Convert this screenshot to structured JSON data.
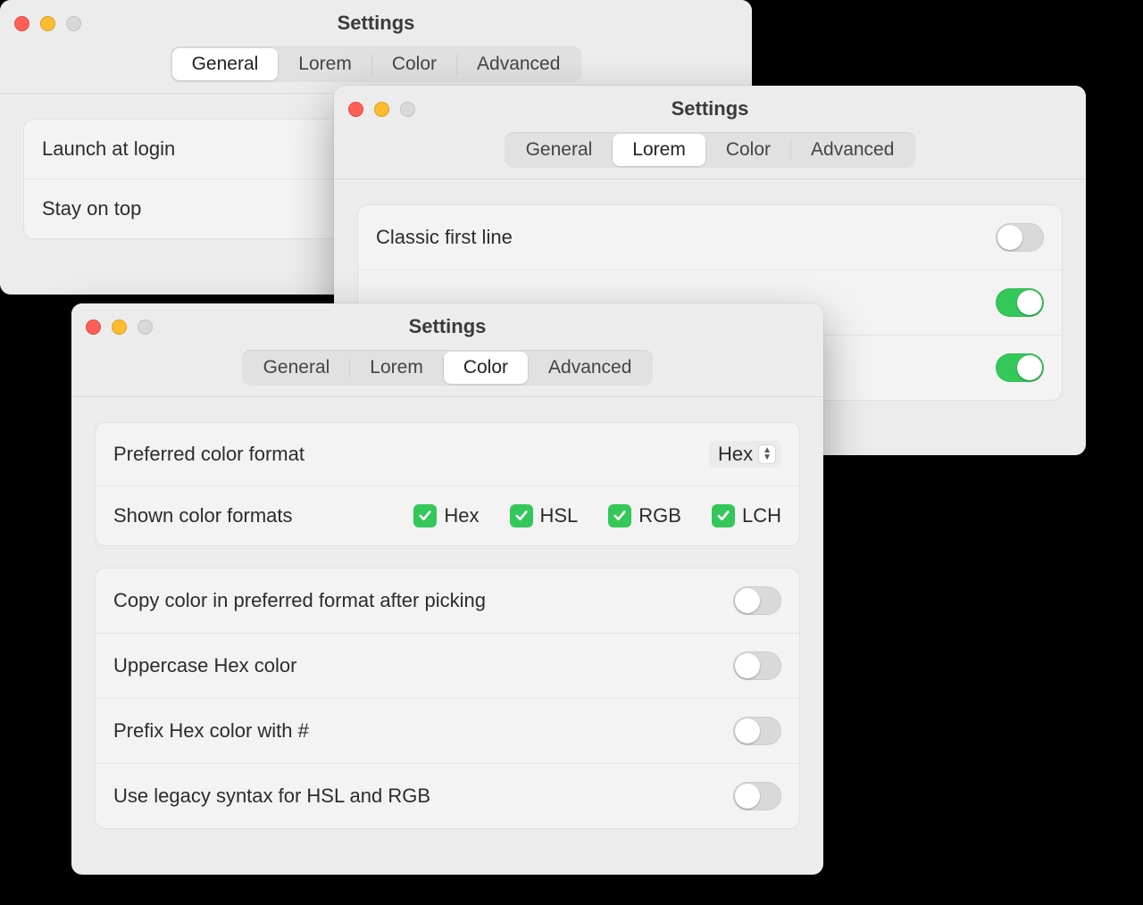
{
  "windows": {
    "general": {
      "title": "Settings",
      "tabs": [
        "General",
        "Lorem",
        "Color",
        "Advanced"
      ],
      "active_tab": "General",
      "rows": {
        "launch": "Launch at login",
        "stayontop": "Stay on top"
      }
    },
    "lorem": {
      "title": "Settings",
      "tabs": [
        "General",
        "Lorem",
        "Color",
        "Advanced"
      ],
      "active_tab": "Lorem",
      "rows": {
        "classic": "Classic first line"
      },
      "toggles": {
        "classic": false,
        "row2": true,
        "row3": true
      }
    },
    "color": {
      "title": "Settings",
      "tabs": [
        "General",
        "Lorem",
        "Color",
        "Advanced"
      ],
      "active_tab": "Color",
      "pref_format_label": "Preferred color format",
      "pref_format_value": "Hex",
      "shown_label": "Shown color formats",
      "formats": {
        "hex": "Hex",
        "hsl": "HSL",
        "rgb": "RGB",
        "lch": "LCH"
      },
      "checks": {
        "hex": true,
        "hsl": true,
        "rgb": true,
        "lch": true
      },
      "below": {
        "copy_after": "Copy color in preferred format after picking",
        "uppercase": "Uppercase Hex color",
        "prefix": "Prefix Hex color with #",
        "legacy": "Use legacy syntax for HSL and RGB"
      },
      "toggles": {
        "copy_after": false,
        "uppercase": false,
        "prefix": false,
        "legacy": false
      }
    }
  }
}
